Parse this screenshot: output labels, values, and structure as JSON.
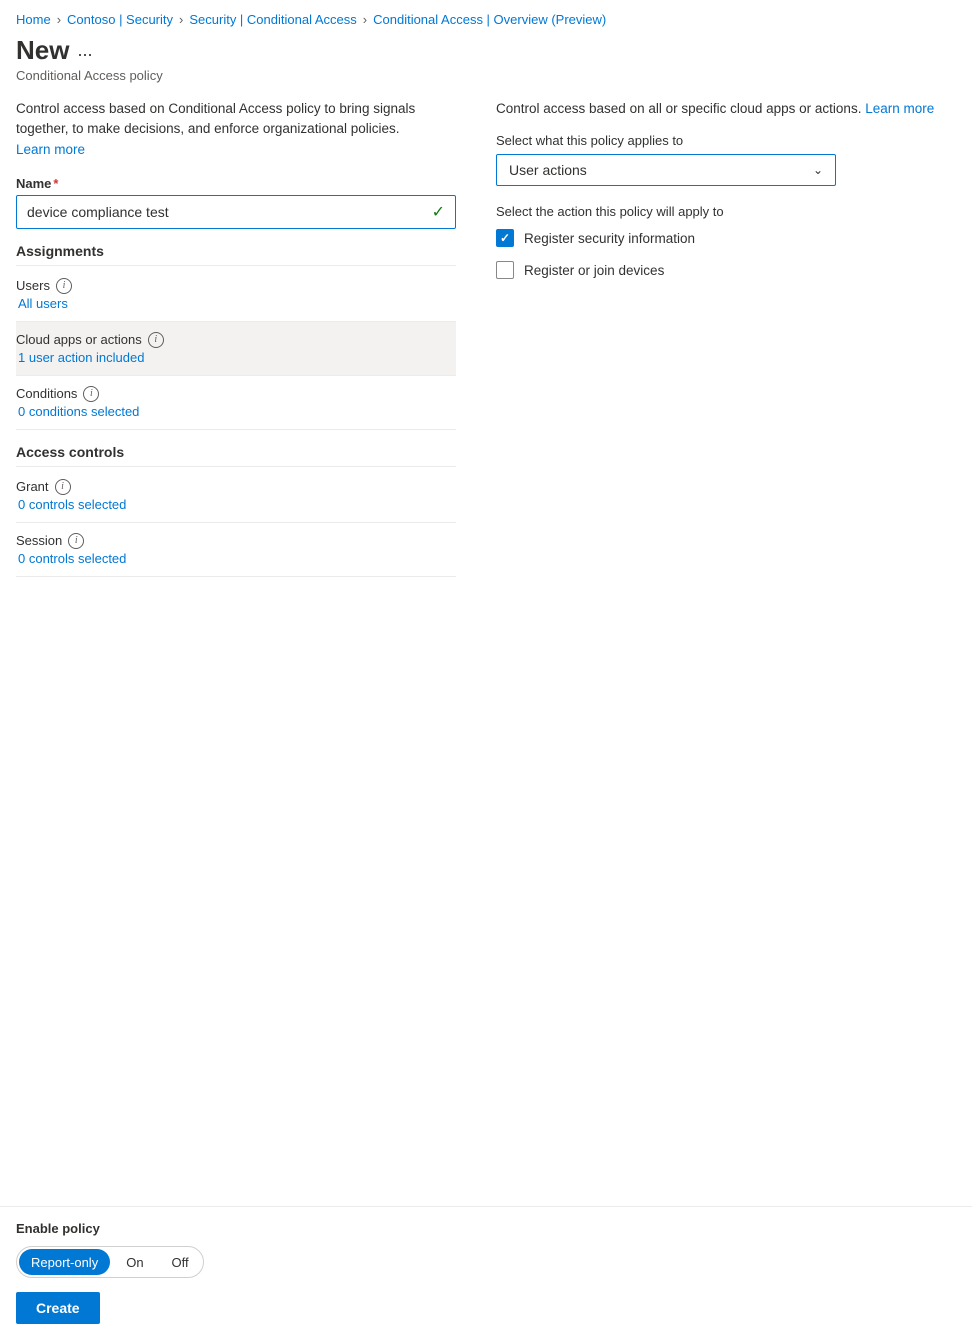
{
  "breadcrumb": {
    "items": [
      {
        "label": "Home",
        "href": "#"
      },
      {
        "label": "Contoso | Security",
        "href": "#"
      },
      {
        "label": "Security | Conditional Access",
        "href": "#"
      },
      {
        "label": "Conditional Access | Overview (Preview)",
        "href": "#"
      }
    ],
    "separators": [
      ">",
      ">",
      ">"
    ]
  },
  "header": {
    "title": "New",
    "ellipsis": "...",
    "subtitle": "Conditional Access policy"
  },
  "left_panel": {
    "description": "Control access based on Conditional Access policy to bring signals together, to make decisions, and enforce organizational policies.",
    "learn_more": "Learn more",
    "name_label": "Name",
    "name_value": "device compliance test",
    "assignments_header": "Assignments",
    "users_label": "Users",
    "users_value": "All users",
    "cloud_apps_label": "Cloud apps or actions",
    "cloud_apps_value": "1 user action included",
    "conditions_label": "Conditions",
    "conditions_value": "0 conditions selected",
    "access_controls_header": "Access controls",
    "grant_label": "Grant",
    "grant_value": "0 controls selected",
    "session_label": "Session",
    "session_value": "0 controls selected"
  },
  "right_panel": {
    "description": "Control access based on all or specific cloud apps or actions.",
    "learn_more": "Learn more",
    "select_label": "Select what this policy applies to",
    "dropdown_value": "User actions",
    "action_label": "Select the action this policy will apply to",
    "checkboxes": [
      {
        "label": "Register security information",
        "checked": true
      },
      {
        "label": "Register or join devices",
        "checked": false
      }
    ]
  },
  "footer": {
    "enable_policy_label": "Enable policy",
    "toggle_options": [
      {
        "label": "Report-only",
        "selected": true
      },
      {
        "label": "On",
        "selected": false
      },
      {
        "label": "Off",
        "selected": false
      }
    ],
    "create_button": "Create"
  }
}
